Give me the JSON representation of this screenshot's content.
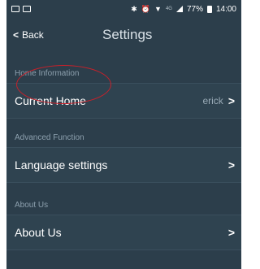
{
  "status_bar": {
    "battery_percent": "77%",
    "time": "14:00",
    "network_label": "4G"
  },
  "header": {
    "back_label": "Back",
    "title": "Settings"
  },
  "sections": [
    {
      "title": "Home Information",
      "rows": [
        {
          "label": "Current Home",
          "value": "erick"
        }
      ]
    },
    {
      "title": "Advanced Function",
      "rows": [
        {
          "label": "Language settings",
          "value": ""
        }
      ]
    },
    {
      "title": "About Us",
      "rows": [
        {
          "label": "About Us",
          "value": ""
        }
      ]
    }
  ],
  "colors": {
    "background": "#2c3e4b",
    "row_background": "#2f4350",
    "section_header_text": "#8da0ae",
    "highlight_ring": "#c8202a"
  },
  "icons": [
    "image-icon",
    "photo-icon",
    "bluetooth-icon",
    "alarm-icon",
    "wifi-icon",
    "signal-icon",
    "battery-icon",
    "back-chevron-icon",
    "chevron-right-icon"
  ]
}
